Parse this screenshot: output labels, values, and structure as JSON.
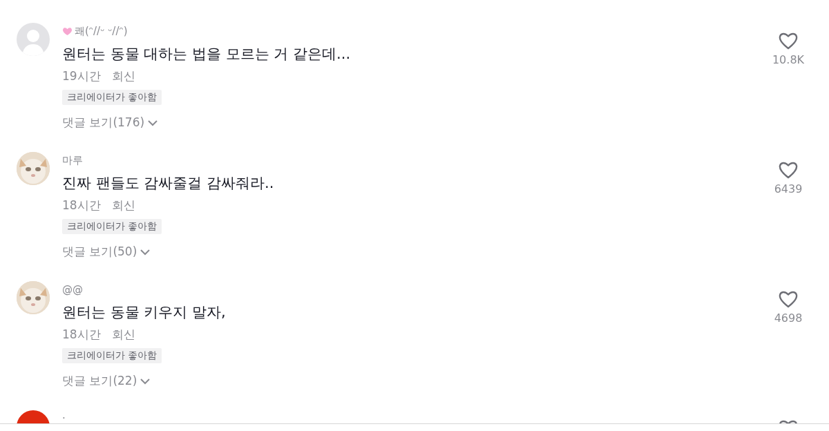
{
  "comments": [
    {
      "kind": "default",
      "heart_mark": true,
      "username": "쾌(ᵔ//ᵕ ᵕ//ᵔ)",
      "text": "원터는 동물 대하는 법을 모르는 거 같은데...",
      "time": "19시간",
      "reply": "회신",
      "badge": "크리에이터가 좋아함",
      "view_replies": "댓글 보기(176)",
      "likes": "10.8K"
    },
    {
      "kind": "picture",
      "heart_mark": false,
      "username": "마루",
      "text": "진짜 팬들도 감싸줄걸 감싸줘라..",
      "time": "18시간",
      "reply": "회신",
      "badge": "크리에이터가 좋아함",
      "view_replies": "댓글 보기(50)",
      "likes": "6439"
    },
    {
      "kind": "picture",
      "heart_mark": false,
      "username": "@@",
      "text": "원터는 동물 키우지 말자,",
      "time": "18시간",
      "reply": "회신",
      "badge": "크리에이터가 좋아함",
      "view_replies": "댓글 보기(22)",
      "likes": "4698"
    },
    {
      "kind": "red",
      "heart_mark": false,
      "username": "·"
    }
  ]
}
